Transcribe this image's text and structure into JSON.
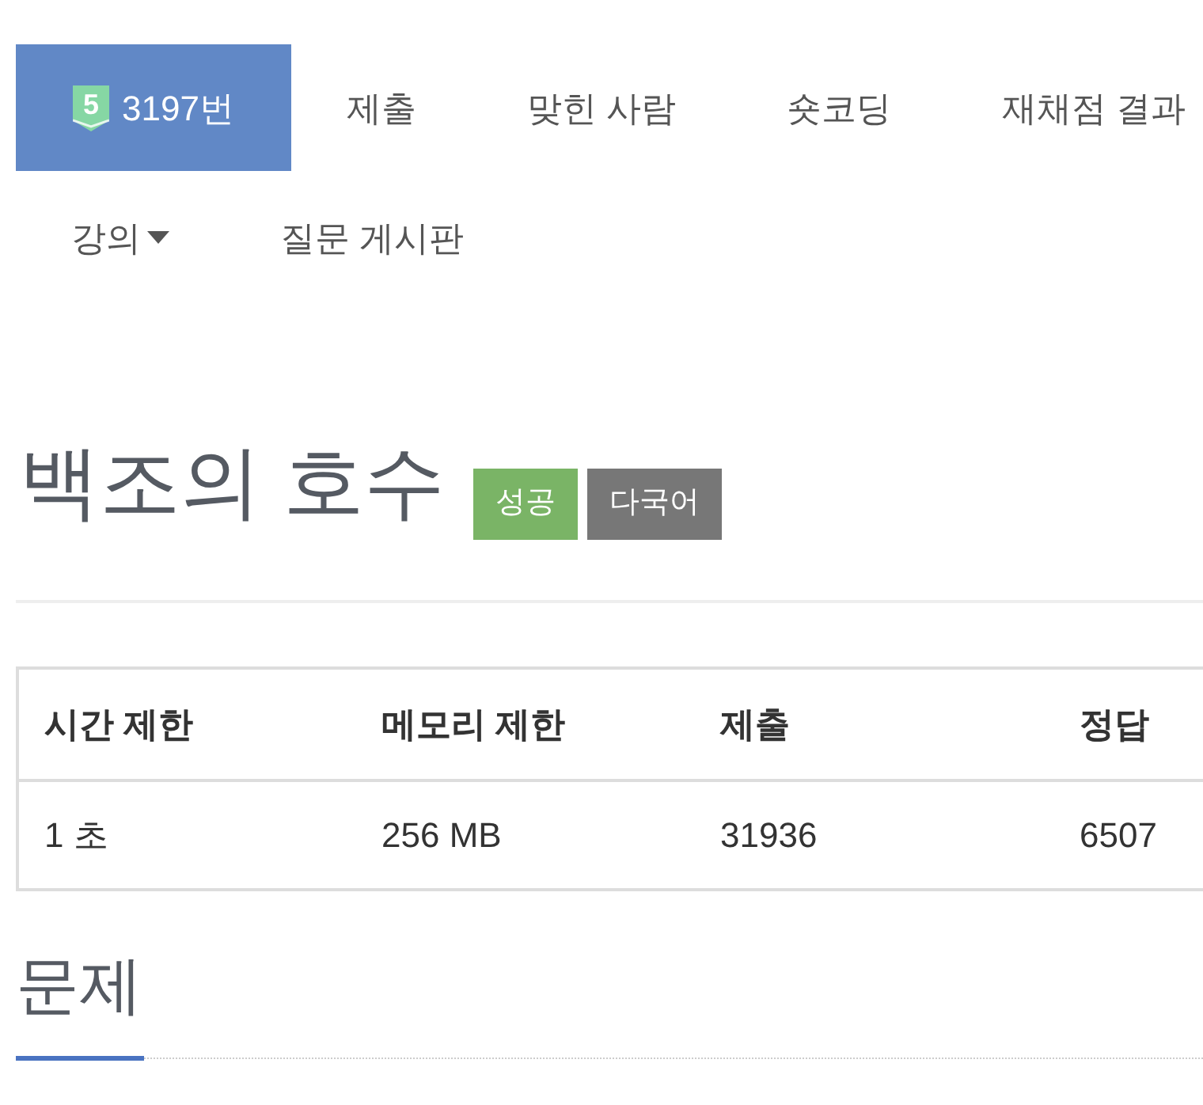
{
  "nav": {
    "tabs": [
      {
        "label": "3197번",
        "badge": "5",
        "selected": true
      },
      {
        "label": "제출",
        "selected": false
      },
      {
        "label": "맞힌 사람",
        "selected": false
      },
      {
        "label": "숏코딩",
        "selected": false
      },
      {
        "label": "재채점 결과",
        "selected": false
      }
    ],
    "menu": [
      {
        "label": "강의",
        "kind": "dropdown"
      },
      {
        "label": "질문 게시판",
        "kind": "link"
      }
    ]
  },
  "problem": {
    "title": "백조의 호수",
    "labels": [
      {
        "text": "성공",
        "color": "#7ab466"
      },
      {
        "text": "다국어",
        "color": "#777777"
      }
    ]
  },
  "info_table": {
    "columns": [
      "시간 제한",
      "메모리 제한",
      "제출",
      "정답"
    ],
    "rows": [
      [
        "1 초",
        "256 MB",
        "31936",
        "6507"
      ]
    ]
  },
  "section": {
    "title": "문제"
  }
}
